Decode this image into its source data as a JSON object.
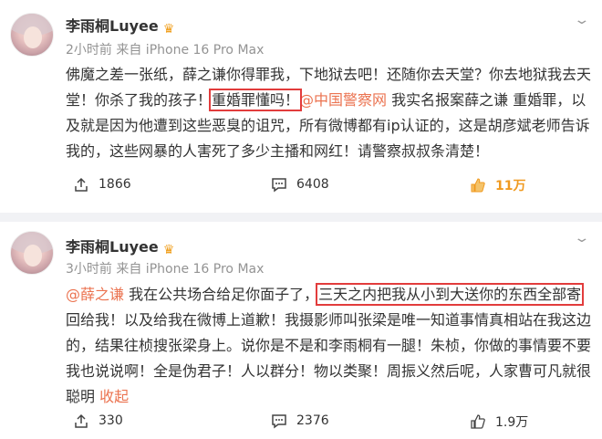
{
  "posts": [
    {
      "author": "李雨桐Luyee",
      "badge_icon": "crown-badge-icon",
      "meta": "2小时前  来自 iPhone 16 Pro Max",
      "text": {
        "p1": "佛魔之差一张纸，薛之谦你得罪我，下地狱去吧！还随你去天堂？你去地狱我去天",
        "p2a": "堂！你杀了我的孩子！",
        "p2_highlight": "重婚罪懂吗！",
        "p2_mention": "@中国警察网",
        "p2b": " 我实名报案薛之谦 重婚罪，以",
        "p3": "及就是因为他遭到这些恶臭的诅咒，所有微博都有ip认证的，这是胡彦斌老师告诉",
        "p4": "我的，这些网暴的人害死了多少主播和网红！请警察叔叔条清楚！"
      },
      "reposts": "1866",
      "comments": "6408",
      "likes": "11万",
      "liked": true
    },
    {
      "author": "李雨桐Luyee",
      "badge_icon": "crown-badge-icon",
      "meta": "3小时前  来自 iPhone 16 Pro Max",
      "text": {
        "p1_mention": "@薛之谦",
        "p1a": " 我在公共场合给足你面子了，",
        "p1_highlight": "三天之内把我从小到大送你的东西全部寄",
        "p2": "回给我！以及给我在微博上道歉！我摄影师叫张梁是唯一知道事情真相站在我这边",
        "p3": "的，结果往桢搜张梁身上。说你是不是和李雨桐有一腿！朱桢，你做的事情要不要",
        "p4": "我也说说啊！全是伪君子！人以群分！物以类聚！周振义然后呢，人家曹可凡就很",
        "p5": "聪明 ",
        "collapse": "收起"
      },
      "reposts": "330",
      "comments": "2376",
      "likes": "1.9万",
      "liked": false
    }
  ],
  "colors": {
    "mention": "#eb7350",
    "highlight_box": "#e23c3c",
    "like_active": "#f09a20",
    "meta": "#939393",
    "separator": "#f1f2f5"
  }
}
